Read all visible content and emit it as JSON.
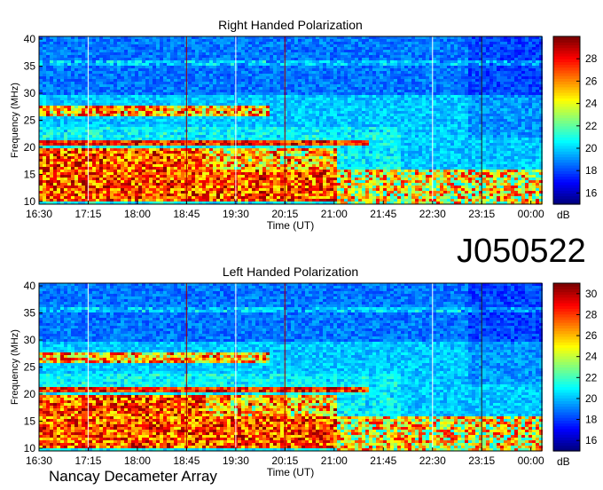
{
  "figure_id": "J050522",
  "footer": "Nancay Decameter Array",
  "chart_data": [
    {
      "type": "heatmap",
      "title": "Right Handed Polarization",
      "xlabel": "Time (UT)",
      "ylabel": "Frequency (MHz)",
      "x_ticks": [
        "16:30",
        "17:15",
        "18:00",
        "18:45",
        "19:30",
        "20:15",
        "21:00",
        "21:45",
        "22:30",
        "23:15",
        "00:00"
      ],
      "y_ticks": [
        10,
        15,
        20,
        25,
        30,
        35,
        40
      ],
      "ylim": [
        9.5,
        40.5
      ],
      "xrange_ut": [
        "16:30",
        "00:10"
      ],
      "colorbar": {
        "label": "dB",
        "ticks": [
          16,
          18,
          20,
          22,
          24,
          26,
          28
        ],
        "range": [
          15,
          30
        ]
      },
      "description_of_intensity": {
        "strong_bands_mhz": [
          [
            10,
            20
          ],
          [
            21,
            22
          ],
          [
            26,
            28
          ]
        ],
        "strong_until_ut": "21:00"
      }
    },
    {
      "type": "heatmap",
      "title": "Left Handed Polarization",
      "xlabel": "Time (UT)",
      "ylabel": "Frequency (MHz)",
      "x_ticks": [
        "16:30",
        "17:15",
        "18:00",
        "18:45",
        "19:30",
        "20:15",
        "21:00",
        "21:45",
        "22:30",
        "23:15",
        "00:00"
      ],
      "y_ticks": [
        10,
        15,
        20,
        25,
        30,
        35,
        40
      ],
      "ylim": [
        9.5,
        40.5
      ],
      "xrange_ut": [
        "16:30",
        "00:10"
      ],
      "colorbar": {
        "label": "dB",
        "ticks": [
          16,
          18,
          20,
          22,
          24,
          26,
          28,
          30
        ],
        "range": [
          15,
          31
        ]
      },
      "description_of_intensity": {
        "strong_bands_mhz": [
          [
            10,
            20
          ],
          [
            21,
            22
          ],
          [
            26,
            28
          ]
        ],
        "strong_until_ut": "21:00"
      }
    }
  ]
}
